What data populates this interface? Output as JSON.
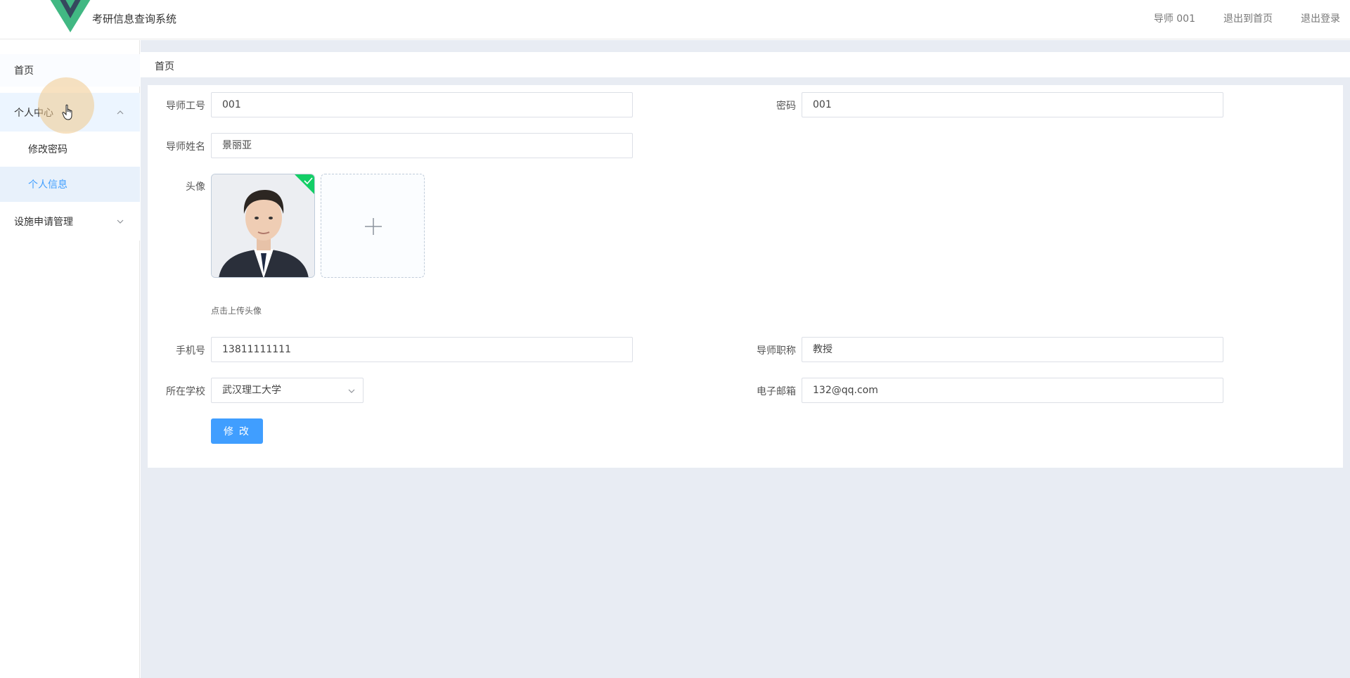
{
  "header": {
    "title": "考研信息查询系统",
    "user": "导师 001",
    "back_home": "退出到首页",
    "logout": "退出登录"
  },
  "sidebar": {
    "home": "首页",
    "personal_center": "个人中心",
    "change_password": "修改密码",
    "personal_info": "个人信息",
    "facility_mgmt": "设施申请管理"
  },
  "breadcrumb": "首页",
  "form": {
    "teacher_id": {
      "label": "导师工号",
      "value": "001"
    },
    "password": {
      "label": "密码",
      "value": "001"
    },
    "teacher_name": {
      "label": "导师姓名",
      "value": "景丽亚"
    },
    "avatar": {
      "label": "头像",
      "tip": "点击上传头像"
    },
    "phone": {
      "label": "手机号",
      "value": "13811111111"
    },
    "title": {
      "label": "导师职称",
      "value": "教授"
    },
    "school": {
      "label": "所在学校",
      "value": "武汉理工大学"
    },
    "email": {
      "label": "电子邮箱",
      "value": "132@qq.com"
    },
    "submit": "修 改"
  },
  "colors": {
    "primary": "#409eff",
    "success": "#13ce66",
    "logo_green": "#41b883",
    "logo_dark": "#35495e",
    "main_bg": "#e8ecf3"
  },
  "icons": [
    "vue-logo-icon",
    "chevron-up-icon",
    "chevron-down-icon",
    "plus-icon",
    "check-icon",
    "hand-cursor-icon"
  ]
}
